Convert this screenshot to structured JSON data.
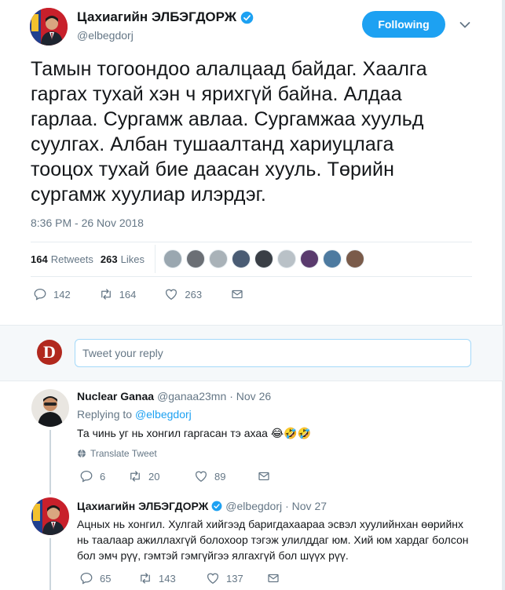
{
  "author": {
    "name": "Цахиагийн ЭЛБЭГДОРЖ",
    "handle": "@elbegdorj",
    "follow_label": "Following"
  },
  "tweet": {
    "lines": [
      "Тамын тогоондоо алалцаад байдаг. Хаалга",
      "гаргах тухай хэн ч ярихгүй байна. Алдаа",
      "гарлаа. Сургамж авлаа. Сургамжаа хуульд",
      "суулгах. Албан тушаалтанд хариуцлага",
      "тооцох тухай бие даасан хууль. Төрийн",
      "сургамж хуулиар илэрдэг."
    ],
    "time": "8:36 PM - 26 Nov 2018",
    "retweets_count": "164",
    "retweets_label": "Retweets",
    "likes_count": "263",
    "likes_label": "Likes",
    "liker_colors": [
      "#9aa7b0",
      "#6b6f75",
      "#a9b2b8",
      "#4a5c74",
      "#3a3f46",
      "#b9c1c7",
      "#5a3b6e",
      "#4d7aa0",
      "#7a5b4a"
    ],
    "actions": {
      "replies": "142",
      "retweets": "164",
      "likes": "263"
    }
  },
  "reply_box": {
    "avatar_letter": "D",
    "placeholder": "Tweet your reply"
  },
  "replies": [
    {
      "name": "Nuclear Ganaa",
      "handle": "@ganaa23mn",
      "date": "· Nov 26",
      "replying_prefix": "Replying to",
      "replying_to": "@elbegdorj",
      "text": "Та чинь уг нь хонгил гаргасан тэ ахаа 😂🤣🤣",
      "translate": "Translate Tweet",
      "replies": "6",
      "retweets": "20",
      "likes": "89"
    },
    {
      "name": "Цахиагийн ЭЛБЭГДОРЖ",
      "handle": "@elbegdorj",
      "date": "· Nov 27",
      "lines": [
        "Ацных нь хонгил. Хулгай хийгээд баригдахаараа эсвэл хуулийнхан өөрийнх",
        "нь таалаар ажиллахгүй болохоор тэгэж улилддаг юм. Хий юм хардаг болсон",
        "бол эмч рүү, гэмтэй гэмгүйгээ ялгахгүй бол шүүх рүү."
      ],
      "replies": "65",
      "retweets": "143",
      "likes": "137"
    }
  ]
}
